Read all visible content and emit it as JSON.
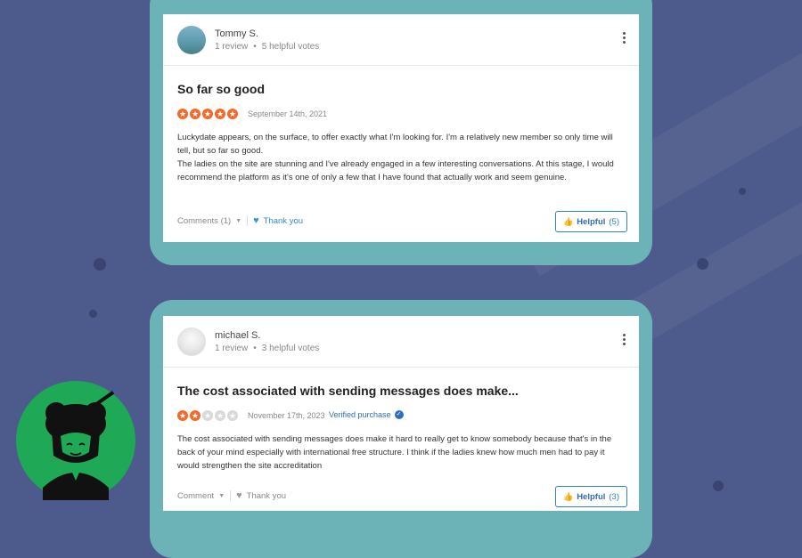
{
  "reviews": [
    {
      "user": "Tommy S.",
      "reviews_count": "1 review",
      "helpful_votes": "5 helpful votes",
      "title": "So far so good",
      "rating": 5,
      "date": "September 14th, 2021",
      "verified": "",
      "body": [
        "Luckydate appears, on the surface, to offer exactly what I'm looking for. I'm a relatively new member so only time will tell, but so far so good.",
        "The ladies on the site are stunning and I've already engaged in a few interesting conversations. At this stage, I would recommend the platform as it's one of only a few that I have found that actually work and seem genuine."
      ],
      "comments_label": "Comments (1)",
      "thank_label": "Thank you",
      "helpful_label": "Helpful",
      "helpful_count": "(5)"
    },
    {
      "user": "michael S.",
      "reviews_count": "1 review",
      "helpful_votes": "3 helpful votes",
      "title": "The cost associated with sending messages does make...",
      "rating": 2,
      "date": "November 17th, 2023",
      "verified": "Verified purchase",
      "body": [
        "The cost associated with sending messages does make it hard to really get to know somebody because that's in the back of your mind especially with international free structure. I think if the ladies knew how much men had to pay it would strengthen the site accreditation"
      ],
      "comments_label": "Comment",
      "thank_label": "Thank you",
      "helpful_label": "Helpful",
      "helpful_count": "(3)"
    }
  ],
  "icons": {
    "star": "star-icon",
    "heart": "heart-icon",
    "thumb": "thumbs-up-icon",
    "kebab": "more-options-icon",
    "check": "verified-check-icon"
  },
  "colors": {
    "background": "#4d5b8c",
    "frame": "#6cb3b8",
    "star_on": "#f36a2c",
    "star_off": "#d9d9d9",
    "accent_blue": "#2e7fc4",
    "logo_green": "#1fa855"
  }
}
